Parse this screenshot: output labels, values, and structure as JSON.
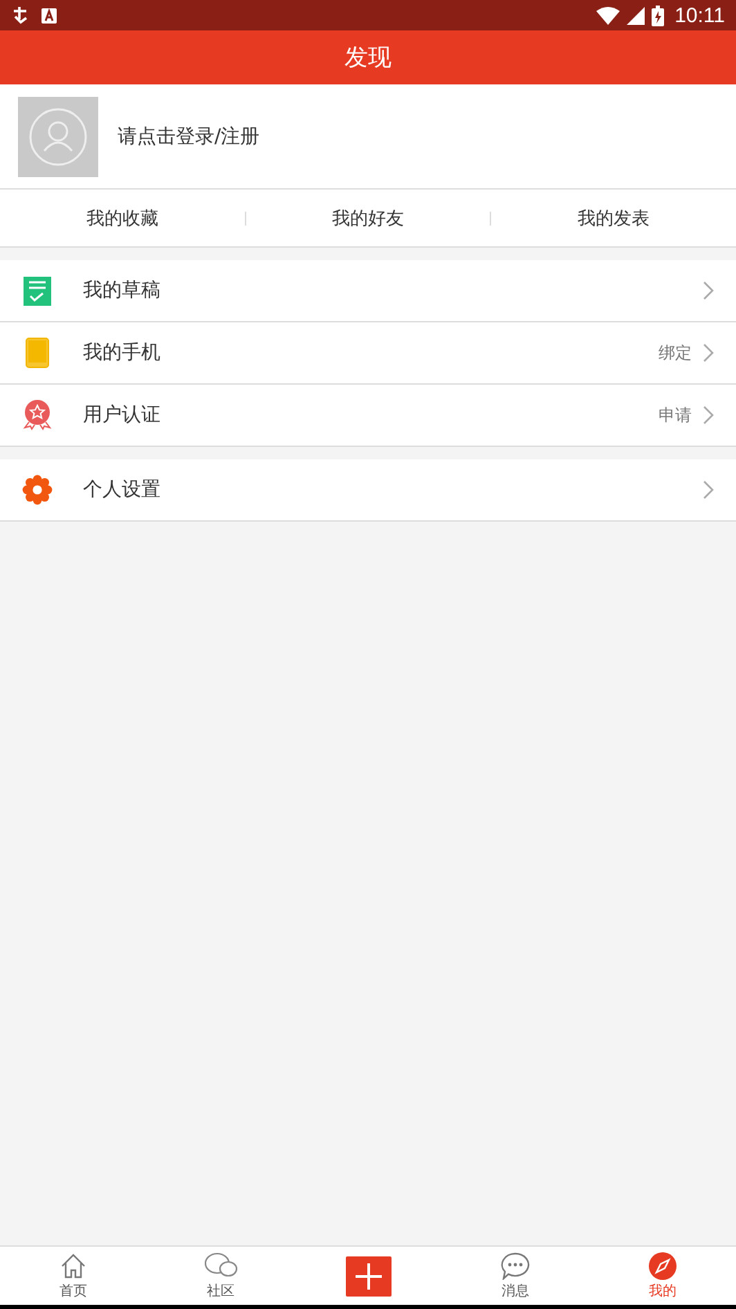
{
  "status_bar": {
    "time": "10:11"
  },
  "header": {
    "title": "发现"
  },
  "profile": {
    "prompt": "请点击登录/注册"
  },
  "stats": [
    {
      "label": "我的收藏"
    },
    {
      "label": "我的好友"
    },
    {
      "label": "我的发表"
    }
  ],
  "menu_groups": [
    [
      {
        "kind": "draft",
        "label": "我的草稿"
      },
      {
        "kind": "phone",
        "label": "我的手机",
        "value": "绑定"
      },
      {
        "kind": "badge",
        "label": "用户认证",
        "value": "申请"
      }
    ],
    [
      {
        "kind": "gear",
        "label": "个人设置"
      }
    ]
  ],
  "bottom_nav": [
    {
      "kind": "home",
      "label": "首页",
      "selected": false
    },
    {
      "kind": "community",
      "label": "社区",
      "selected": false
    },
    {
      "kind": "add"
    },
    {
      "kind": "message",
      "label": "消息",
      "selected": false
    },
    {
      "kind": "mine",
      "label": "我的",
      "selected": true
    }
  ]
}
